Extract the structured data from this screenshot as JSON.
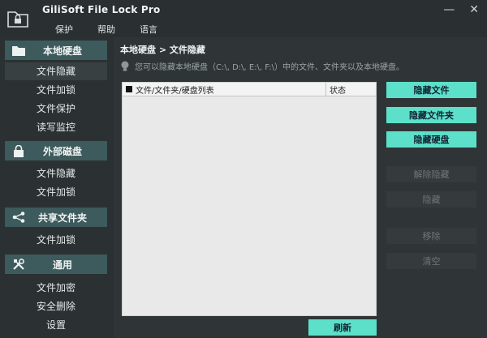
{
  "app": {
    "title": "GiliSoft File Lock Pro"
  },
  "menu": [
    "保护",
    "帮助",
    "语言"
  ],
  "window_buttons": {
    "minimize": "—",
    "close": "✕"
  },
  "sidebar": {
    "sections": [
      {
        "label": "本地硬盘",
        "icon": "folder-icon",
        "items": [
          "文件隐藏",
          "文件加锁",
          "文件保护",
          "读写监控"
        ]
      },
      {
        "label": "外部磁盘",
        "icon": "padlock-icon",
        "items": [
          "文件隐藏",
          "文件加锁"
        ]
      },
      {
        "label": "共享文件夹",
        "icon": "share-icon",
        "items": [
          "文件加锁"
        ]
      },
      {
        "label": "通用",
        "icon": "tools-icon",
        "items": [
          "文件加密",
          "安全删除",
          "设置"
        ]
      }
    ]
  },
  "main": {
    "breadcrumb": "本地硬盘 > 文件隐藏",
    "hint": "您可以隐藏本地硬盘（C:\\, D:\\, E:\\, F:\\）中的文件、文件夹以及本地硬盘。",
    "table_headers": [
      "文件/文件夹/硬盘列表",
      "状态"
    ],
    "buttons": {
      "hide_file": "隐藏文件",
      "hide_folder": "隐藏文件夹",
      "hide_disk": "隐藏硬盘",
      "unhide": "解除隐藏",
      "hide": "隐藏",
      "remove": "移除",
      "clear": "清空",
      "refresh": "刷新"
    }
  },
  "colors": {
    "accent": "#5de0c9",
    "section_header": "#3d5a5c",
    "background": "#2b3133"
  }
}
